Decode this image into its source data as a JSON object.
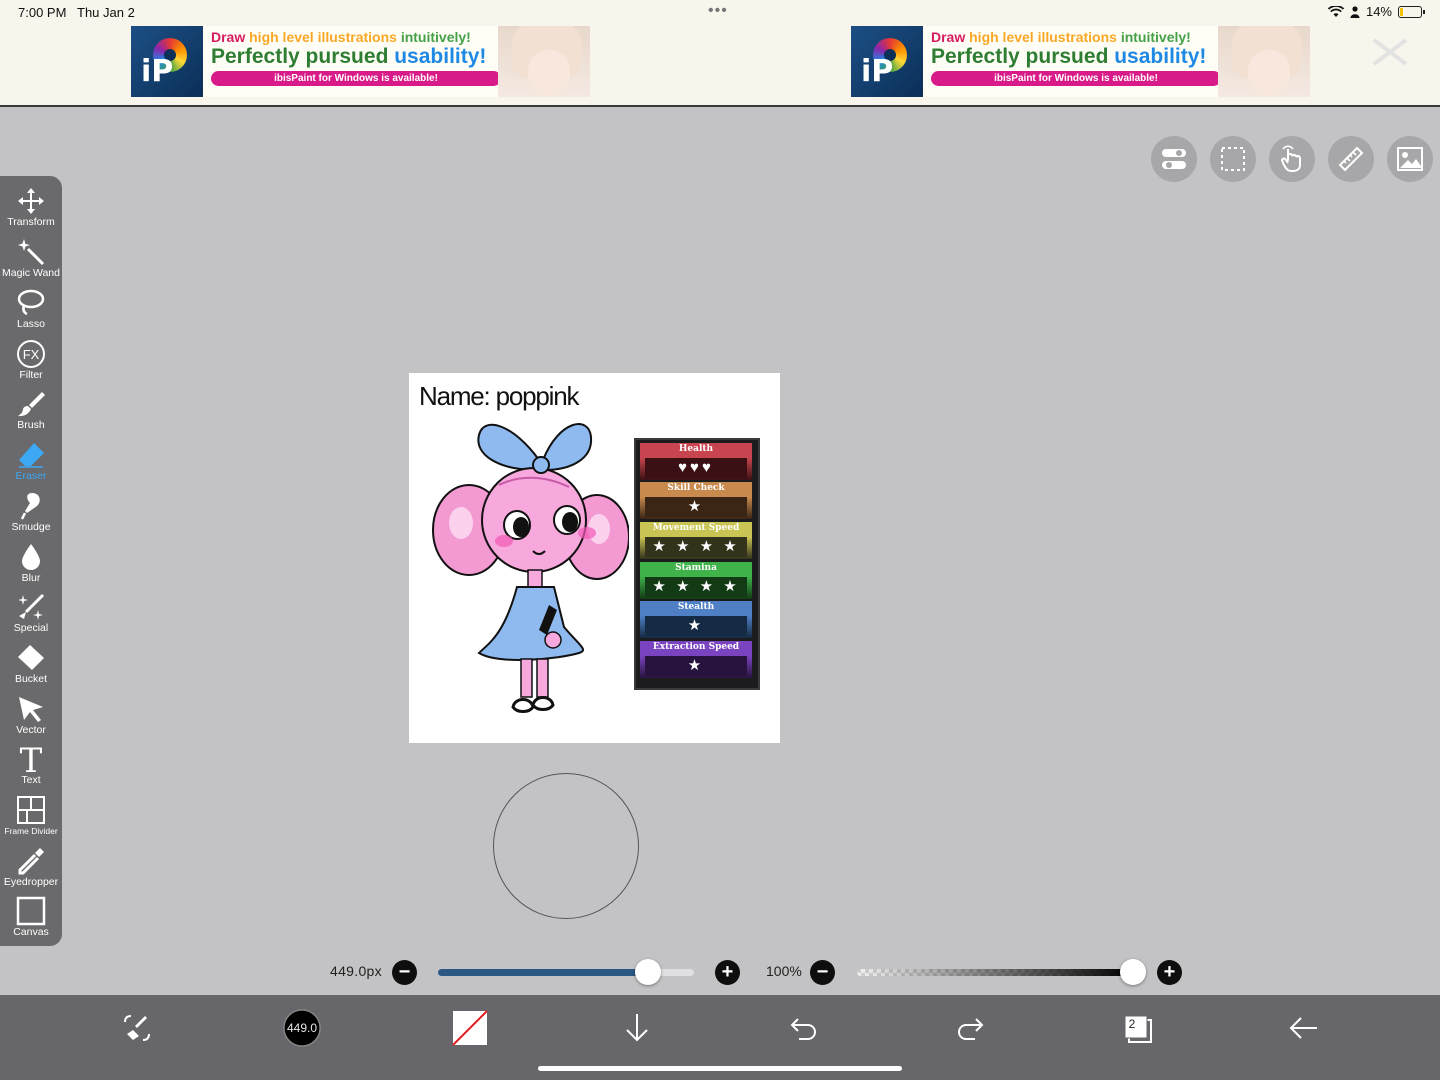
{
  "status_bar": {
    "time": "7:00 PM",
    "date": "Thu Jan 2",
    "dots": "•••",
    "battery": "14%",
    "battery_level": 0.14
  },
  "ads": [
    {
      "line1_a": "Draw ",
      "line1_b": "high level illustrations ",
      "line1_c": "intuitively!",
      "line2_a": "Perfectly pursued ",
      "line2_b": "usability!",
      "pill": "ibisPaint for Windows is available!"
    },
    {
      "line1_a": "Draw ",
      "line1_b": "high level illustrations ",
      "line1_c": "intuitively!",
      "line2_a": "Perfectly pursued ",
      "line2_b": "usability!",
      "pill": "ibisPaint for Windows is available!"
    }
  ],
  "toolbar": {
    "tools": [
      {
        "label": "Transform",
        "icon": "move-arrows-icon"
      },
      {
        "label": "Magic Wand",
        "icon": "magic-wand-icon"
      },
      {
        "label": "Lasso",
        "icon": "lasso-icon"
      },
      {
        "label": "Filter",
        "icon": "fx-icon"
      },
      {
        "label": "Brush",
        "icon": "brush-icon"
      },
      {
        "label": "Eraser",
        "icon": "eraser-icon"
      },
      {
        "label": "Smudge",
        "icon": "smudge-icon"
      },
      {
        "label": "Blur",
        "icon": "blur-drop-icon"
      },
      {
        "label": "Special",
        "icon": "special-sparkle-icon"
      },
      {
        "label": "Bucket",
        "icon": "bucket-icon"
      },
      {
        "label": "Vector",
        "icon": "vector-cursor-icon"
      },
      {
        "label": "Text",
        "icon": "text-icon"
      },
      {
        "label": "Frame Divider",
        "icon": "frame-divider-icon"
      },
      {
        "label": "Eyedropper",
        "icon": "eyedropper-icon"
      },
      {
        "label": "Canvas",
        "icon": "canvas-icon"
      }
    ],
    "active": "Eraser",
    "active_color": "#3da8f5",
    "fx_text": "FX",
    "text_glyph": "T"
  },
  "artwork": {
    "name_text": "Name: poppink",
    "stats": [
      {
        "label": "Health",
        "value": "♥♥♥",
        "color": "#c8454f",
        "dark": "#3a1014"
      },
      {
        "label": "Skill Check",
        "value": "★",
        "color": "#c98a4e",
        "dark": "#3b2515"
      },
      {
        "label": "Movement Speed",
        "value": "★ ★ ★ ★",
        "color": "#c9c453",
        "dark": "#33321a"
      },
      {
        "label": "Stamina",
        "value": "★ ★ ★ ★ ★",
        "color": "#3fb24a",
        "dark": "#123a15"
      },
      {
        "label": "Stealth",
        "value": "★",
        "color": "#4f7fc4",
        "dark": "#152a44"
      },
      {
        "label": "Extraction Speed",
        "value": "★",
        "color": "#7a44c0",
        "dark": "#28133f"
      }
    ]
  },
  "brush_controls": {
    "size_label": "449.0px",
    "size_fraction": 0.82,
    "opacity_label": "100%",
    "opacity_fraction": 1.0,
    "minus": "−",
    "plus": "+"
  },
  "bottom_bar": {
    "brush_size_badge": "449.0",
    "layers_count": "2"
  }
}
